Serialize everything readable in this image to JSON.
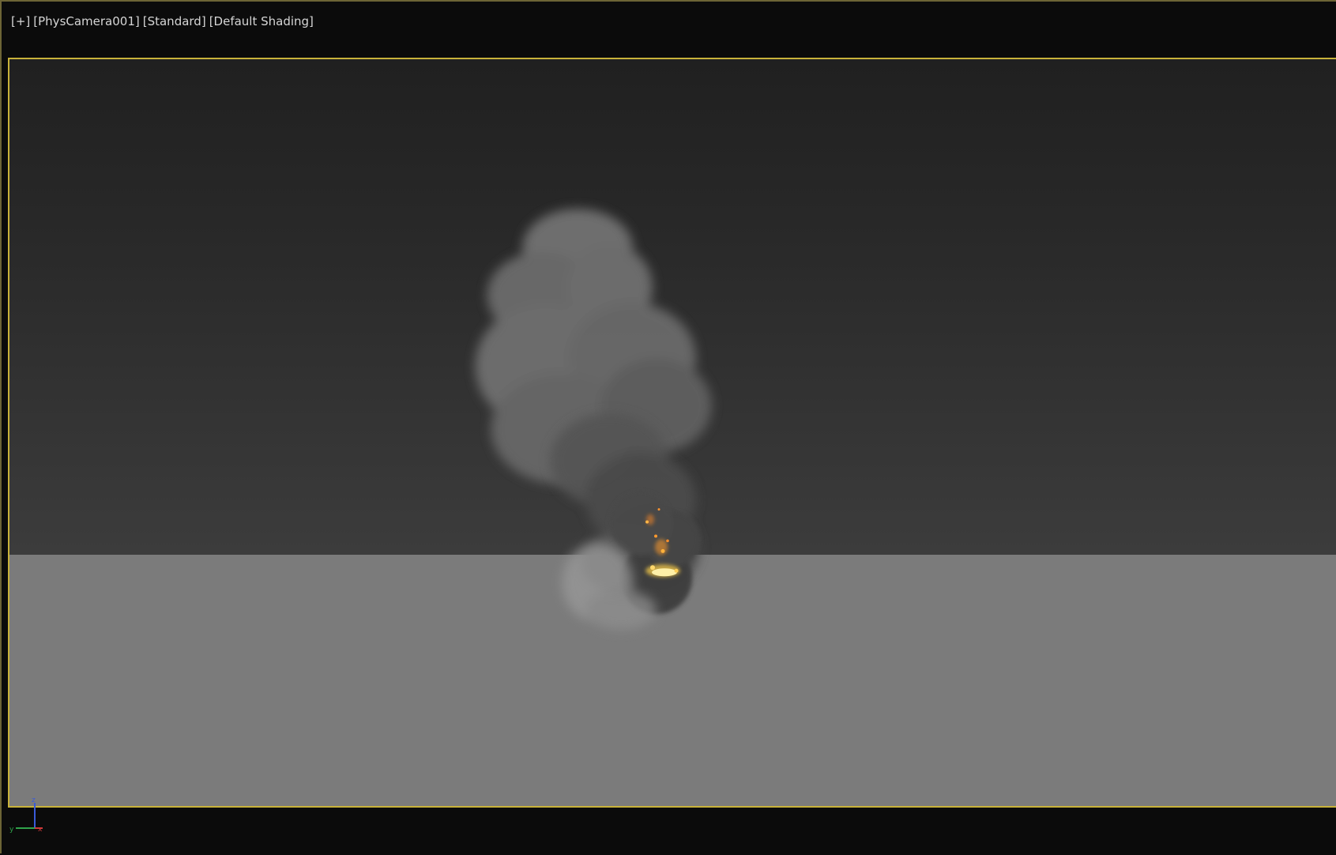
{
  "viewport": {
    "label": {
      "menu": "[+]",
      "camera": "[PhysCamera001]",
      "mode": "[Standard]",
      "shading": "[Default Shading]"
    },
    "colors": {
      "frame": "#c8b23a",
      "ground": "#7b7b7b",
      "sky_top": "#202020",
      "sky_bottom": "#3c3c3c"
    }
  },
  "gizmo": {
    "z": "z",
    "y": "y",
    "x": "x",
    "colors": {
      "z": "#3a5bd9",
      "y": "#2fa34a",
      "x": "#d13a3a"
    }
  },
  "scene": {
    "object": "smoke-plume",
    "icons": [
      "fire-icon"
    ]
  }
}
